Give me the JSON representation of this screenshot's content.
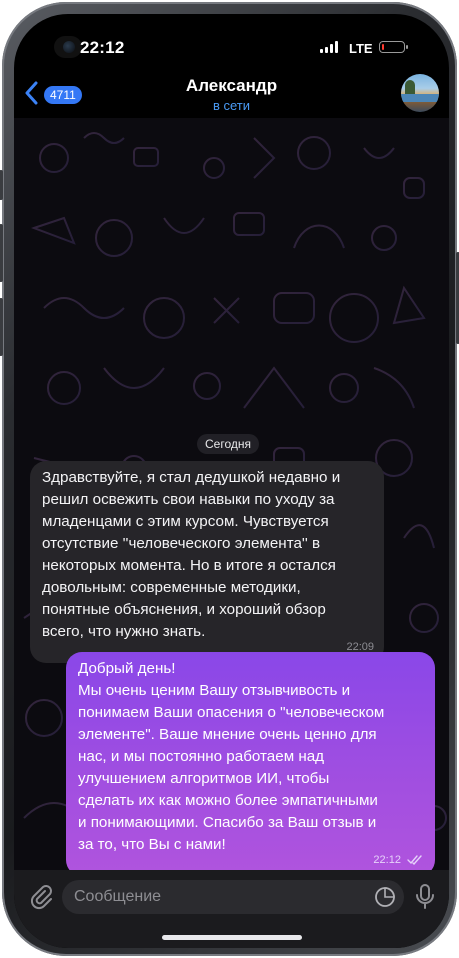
{
  "status_bar": {
    "time": "22:12",
    "network": "LTE",
    "battery_level": 0.12,
    "battery_color": "#ff3b30"
  },
  "header": {
    "back_icon": "chevron-left-icon",
    "unread_count": "4711",
    "contact_name": "Александр",
    "contact_status": "в сети",
    "status_color": "#4a9bf5",
    "avatar_icon": "contact-avatar"
  },
  "chat": {
    "date_separator": "Сегодня",
    "messages": [
      {
        "direction": "incoming",
        "lines": [
          "Здравствуйте, я стал дедушкой недавно и",
          "решил освежить свои навыки по уходу за",
          "младенцами с этим курсом. Чувствуется",
          "отсутствие ''человеческого элемента'' в",
          "некоторых момента. Но в итоге я остался",
          "довольным: современные методики,",
          "понятные объяснения, и хороший обзор",
          "всего, что нужно знать."
        ],
        "time": "22:09"
      },
      {
        "direction": "outgoing",
        "lines": [
          "Добрый день!",
          "Мы очень ценим Вашу отзывчивость и",
          "понимаем Ваши опасения о \"человеческом",
          "элементе\". Ваше мнение очень ценно для",
          "нас, и мы постоянно работаем над",
          "улучшением алгоритмов ИИ, чтобы",
          "сделать их как можно более эмпатичными",
          "и понимающими. Спасибо за Ваш отзыв и",
          "за то, что Вы с нами!"
        ],
        "time": "22:12",
        "read_icon": "double-check-icon"
      }
    ]
  },
  "input_bar": {
    "placeholder": "Сообщение",
    "attach_icon": "paperclip-icon",
    "sticker_icon": "sticker-icon",
    "mic_icon": "microphone-icon"
  },
  "colors": {
    "incoming_bubble": "#262529",
    "outgoing_bubble": "#9a4ee3",
    "accent": "#3478f6"
  }
}
